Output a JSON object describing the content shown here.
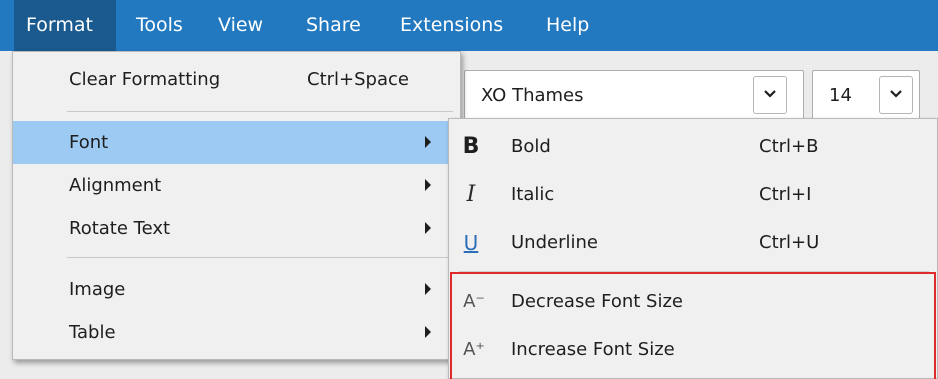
{
  "menubar": {
    "items": [
      "Format",
      "Tools",
      "View",
      "Share",
      "Extensions",
      "Help"
    ]
  },
  "toolbar": {
    "font_name": "XO Thames",
    "font_size": "14"
  },
  "format_menu": {
    "items": [
      {
        "label": "Clear Formatting",
        "shortcut": "Ctrl+Space"
      },
      {
        "label": "Font"
      },
      {
        "label": "Alignment"
      },
      {
        "label": "Rotate Text"
      },
      {
        "label": "Image"
      },
      {
        "label": "Table"
      }
    ]
  },
  "font_submenu": {
    "items": [
      {
        "icon": "bold-icon",
        "glyph": "B",
        "label": "Bold",
        "shortcut": "Ctrl+B"
      },
      {
        "icon": "italic-icon",
        "glyph": "I",
        "label": "Italic",
        "shortcut": "Ctrl+I"
      },
      {
        "icon": "underline-icon",
        "glyph": "U",
        "label": "Underline",
        "shortcut": "Ctrl+U"
      },
      {
        "icon": "decrease-font-size-icon",
        "glyph": "A⁻",
        "label": "Decrease Font Size"
      },
      {
        "icon": "increase-font-size-icon",
        "glyph": "A⁺",
        "label": "Increase Font Size"
      }
    ]
  },
  "colors": {
    "menubar_bg": "#2279c0",
    "menu_highlight": "#9ccaf2",
    "annotation_box": "#e02a2a",
    "icon_blue": "#2a6fb8"
  }
}
